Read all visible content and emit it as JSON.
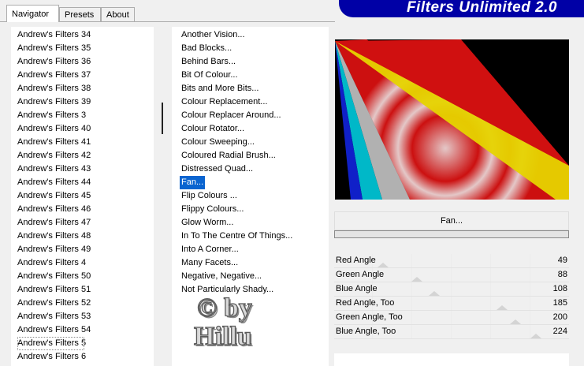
{
  "tabs": [
    {
      "label": "Navigator",
      "active": true
    },
    {
      "label": "Presets",
      "active": false
    },
    {
      "label": "About",
      "active": false
    }
  ],
  "banner": {
    "title": "Filters Unlimited 2.0",
    "color": "#0000a6"
  },
  "categories": [
    "Andrew's Filters 34",
    "Andrew's Filters 35",
    "Andrew's Filters 36",
    "Andrew's Filters 37",
    "Andrew's Filters 38",
    "Andrew's Filters 39",
    "Andrew's Filters 3",
    "Andrew's Filters 40",
    "Andrew's Filters 41",
    "Andrew's Filters 42",
    "Andrew's Filters 43",
    "Andrew's Filters 44",
    "Andrew's Filters 45",
    "Andrew's Filters 46",
    "Andrew's Filters 47",
    "Andrew's Filters 48",
    "Andrew's Filters 49",
    "Andrew's Filters 4",
    "Andrew's Filters 50",
    "Andrew's Filters 51",
    "Andrew's Filters 52",
    "Andrew's Filters 53",
    "Andrew's Filters 54",
    "Andrew's Filters 5",
    "Andrew's Filters 6"
  ],
  "current_category": "Andrew's Filters 5",
  "filters": [
    "Another Vision...",
    "Bad Blocks...",
    "Behind Bars...",
    "Bit Of Colour...",
    "Bits and More Bits...",
    "Colour Replacement...",
    "Colour Replacer Around...",
    "Colour Rotator...",
    "Colour Sweeping...",
    "Coloured Radial Brush...",
    "Distressed Quad...",
    "Fan...",
    "Flip Colours ...",
    "Flippy Colours...",
    "Glow Worm...",
    "In To The Centre Of Things...",
    "Into A Corner...",
    "Many Facets...",
    "Negative, Negative...",
    "Not Particularly Shady..."
  ],
  "selected_filter": "Fan...",
  "selected_filter_label": "Fan...",
  "sliders": [
    {
      "label": "Red Angle",
      "value": 49
    },
    {
      "label": "Green Angle",
      "value": 88
    },
    {
      "label": "Blue Angle",
      "value": 108
    },
    {
      "label": "Red Angle, Too",
      "value": 185
    },
    {
      "label": "Green Angle, Too",
      "value": 200
    },
    {
      "label": "Blue Angle, Too",
      "value": 224
    }
  ],
  "slider_max": 255,
  "watermark": {
    "line1": "© by",
    "line2": "Hillu"
  },
  "colors": {
    "selection": "#0a64d0",
    "banner": "#0000a6"
  }
}
